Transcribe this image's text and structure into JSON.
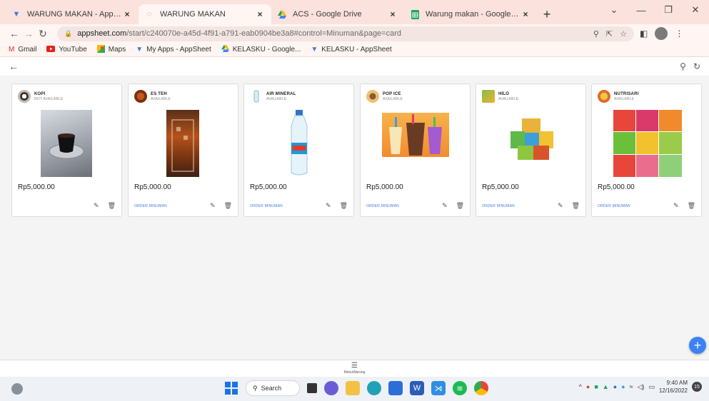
{
  "browser": {
    "tabs": [
      {
        "title": "WARUNG MAKAN - AppSheet",
        "icon": "appsheet-icon",
        "active": false
      },
      {
        "title": "WARUNG MAKAN",
        "icon": "loading-icon",
        "active": true
      },
      {
        "title": "ACS - Google Drive",
        "icon": "google-drive-icon",
        "active": false
      },
      {
        "title": "Warung makan - Google Spreadsh",
        "icon": "google-sheets-icon",
        "active": false
      }
    ],
    "new_tab_label": "+",
    "url_host": "appsheet.com",
    "url_path": "/start/c240070e-a45d-4f91-a791-eab0904be3a8#control=Minuman&page=card",
    "bookmarks": [
      {
        "label": "Gmail",
        "icon": "gmail-icon"
      },
      {
        "label": "YouTube",
        "icon": "youtube-icon"
      },
      {
        "label": "Maps",
        "icon": "maps-icon"
      },
      {
        "label": "My Apps - AppSheet",
        "icon": "appsheet-icon"
      },
      {
        "label": "KELASKU - Google...",
        "icon": "google-drive-icon"
      },
      {
        "label": "KELASKU - AppSheet",
        "icon": "appsheet-icon"
      }
    ]
  },
  "cards": [
    {
      "name": "KOPI",
      "status": "NOT AVAILABLE",
      "price": "Rp5,000.00",
      "order_label": "",
      "image_icon": "coffee-image"
    },
    {
      "name": "ES TEH",
      "status": "AVAILABLE",
      "price": "Rp5,000.00",
      "order_label": "ORDER MINUMAN",
      "image_icon": "iced-tea-image"
    },
    {
      "name": "AIR MINERAL",
      "status": "AVAILABLE",
      "price": "Rp5,000.00",
      "order_label": "ORDER MINUMAN",
      "image_icon": "water-bottle-image"
    },
    {
      "name": "POP ICE",
      "status": "AVAILABLE",
      "price": "Rp5,000.00",
      "order_label": "ORDER MINUMAN",
      "image_icon": "pop-ice-image"
    },
    {
      "name": "HILO",
      "status": "AVAILABLE",
      "price": "Rp5,000.00",
      "order_label": "ORDER MINUMAN",
      "image_icon": "hilo-sachet-image"
    },
    {
      "name": "NUTRISARI",
      "status": "AVAILABLE",
      "price": "Rp5,000.00",
      "order_label": "ORDER MINUMAN",
      "image_icon": "nutrisari-sachet-image"
    }
  ],
  "bottom_nav": {
    "label": "MenuWarung",
    "icon": "list-icon"
  },
  "fab_label": "+",
  "taskbar": {
    "search_label": "Search",
    "time": "9:40 AM",
    "date": "12/16/2022",
    "notification_count": "15"
  },
  "colors": {
    "accent_blue": "#3b82f6",
    "tab_strip": "#fbe2dc",
    "content_bg": "#f4f4f4"
  }
}
